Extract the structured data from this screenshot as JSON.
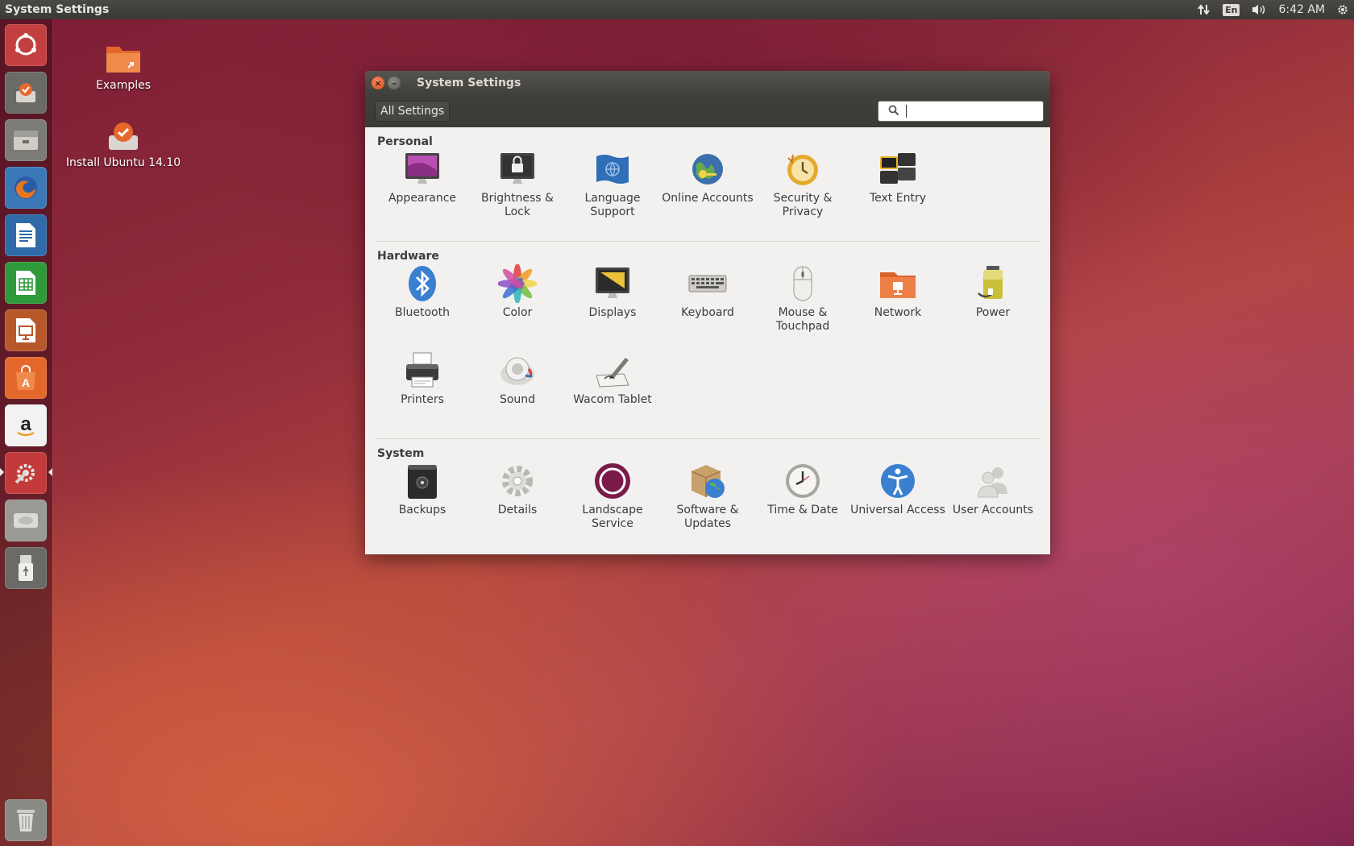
{
  "top_panel": {
    "app_title": "System Settings",
    "keyboard_layout": "En",
    "clock": "6:42 AM"
  },
  "launcher": {
    "items": [
      {
        "name": "dash-home-icon",
        "color": "#c43f3f"
      },
      {
        "name": "install-ubuntu-icon",
        "color": "#6a6a66"
      },
      {
        "name": "files-icon",
        "color": "#7b7b77"
      },
      {
        "name": "firefox-icon",
        "color": "#d66a1c"
      },
      {
        "name": "libreoffice-writer-icon",
        "color": "#2e6ba8"
      },
      {
        "name": "libreoffice-calc-icon",
        "color": "#2e9a3a"
      },
      {
        "name": "libreoffice-impress-icon",
        "color": "#b7582b"
      },
      {
        "name": "ubuntu-software-center-icon",
        "color": "#e4682b"
      },
      {
        "name": "amazon-icon",
        "color": "#f2f2f2"
      },
      {
        "name": "system-settings-icon",
        "color": "#c23a3a"
      },
      {
        "name": "disk-drive-icon",
        "color": "#9a9a95"
      },
      {
        "name": "usb-drive-icon",
        "color": "#6a6a66"
      },
      {
        "name": "trash-icon",
        "color": "#8a8a85"
      }
    ]
  },
  "desktop": {
    "icons": [
      {
        "label": "Examples"
      },
      {
        "label": "Install Ubuntu 14.10"
      }
    ]
  },
  "window": {
    "title": "System Settings",
    "all_settings_label": "All Settings",
    "search": {
      "value": "",
      "placeholder": ""
    },
    "sections": [
      {
        "title": "Personal",
        "items": [
          {
            "label": "Appearance",
            "icon": "appearance-icon"
          },
          {
            "label": "Brightness & Lock",
            "icon": "brightness-lock-icon"
          },
          {
            "label": "Language Support",
            "icon": "language-support-icon"
          },
          {
            "label": "Online Accounts",
            "icon": "online-accounts-icon"
          },
          {
            "label": "Security & Privacy",
            "icon": "security-privacy-icon"
          },
          {
            "label": "Text Entry",
            "icon": "text-entry-icon"
          }
        ]
      },
      {
        "title": "Hardware",
        "items": [
          {
            "label": "Bluetooth",
            "icon": "bluetooth-icon"
          },
          {
            "label": "Color",
            "icon": "color-icon"
          },
          {
            "label": "Displays",
            "icon": "displays-icon"
          },
          {
            "label": "Keyboard",
            "icon": "keyboard-icon"
          },
          {
            "label": "Mouse & Touchpad",
            "icon": "mouse-touchpad-icon"
          },
          {
            "label": "Network",
            "icon": "network-icon"
          },
          {
            "label": "Power",
            "icon": "power-icon"
          },
          {
            "label": "Printers",
            "icon": "printers-icon"
          },
          {
            "label": "Sound",
            "icon": "sound-icon"
          },
          {
            "label": "Wacom Tablet",
            "icon": "wacom-tablet-icon"
          }
        ]
      },
      {
        "title": "System",
        "items": [
          {
            "label": "Backups",
            "icon": "backups-icon"
          },
          {
            "label": "Details",
            "icon": "details-icon"
          },
          {
            "label": "Landscape Service",
            "icon": "landscape-service-icon"
          },
          {
            "label": "Software & Updates",
            "icon": "software-updates-icon"
          },
          {
            "label": "Time & Date",
            "icon": "time-date-icon"
          },
          {
            "label": "Universal Access",
            "icon": "universal-access-icon"
          },
          {
            "label": "User Accounts",
            "icon": "user-accounts-icon"
          }
        ]
      }
    ]
  }
}
